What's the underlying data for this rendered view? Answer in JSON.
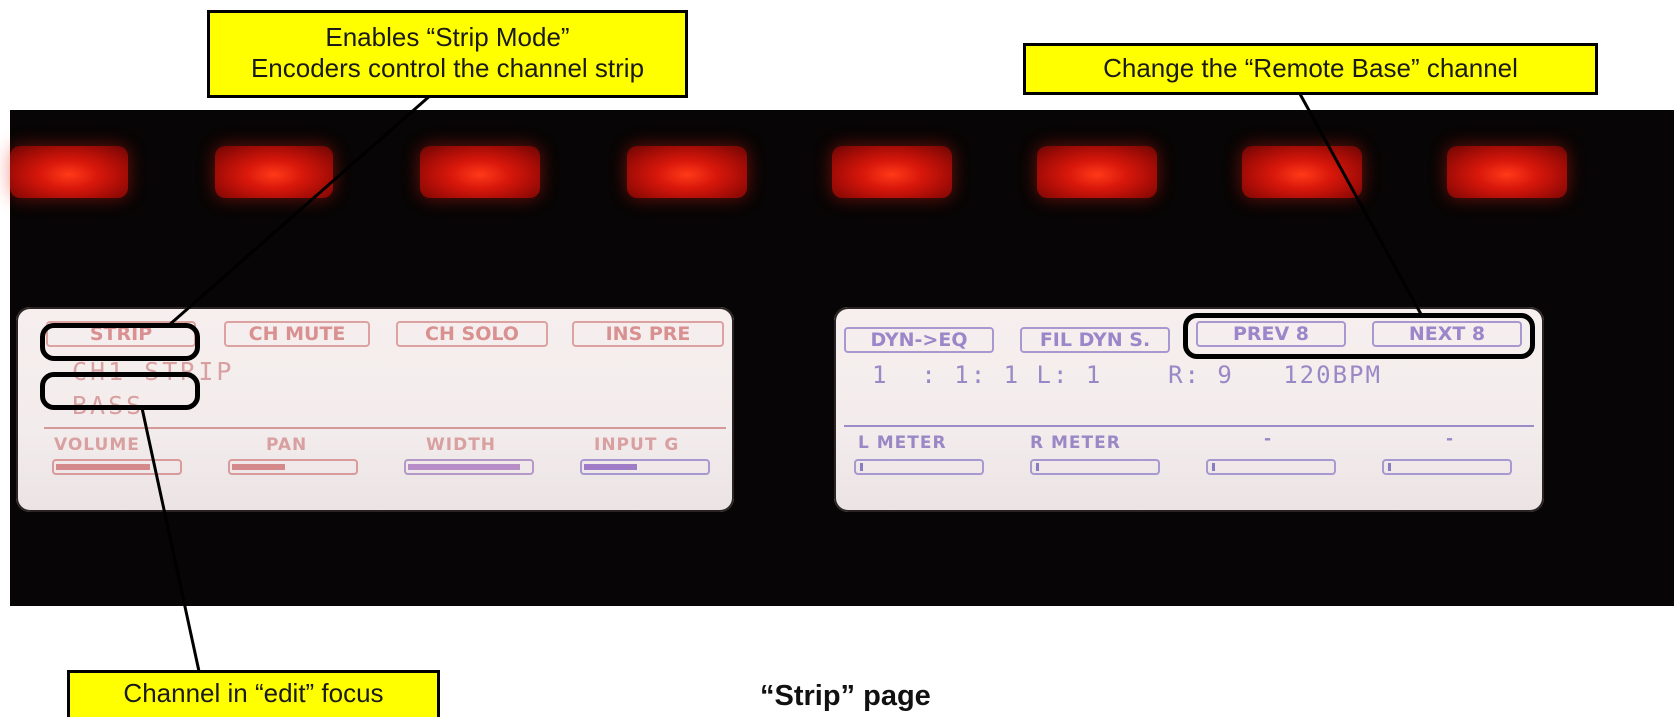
{
  "callouts": {
    "strip_mode_line1": "Enables “Strip Mode”",
    "strip_mode_line2": "Encoders control the channel strip",
    "remote_base": "Change the “Remote Base” channel",
    "edit_focus": "Channel in “edit” focus"
  },
  "caption": "“Strip” page",
  "left_lcd": {
    "softkeys": [
      "STRIP",
      "CH MUTE",
      "CH SOLO",
      "INS PRE"
    ],
    "line1": "CH1 STRIP",
    "line2": "BASS",
    "params": [
      {
        "label": "VOLUME",
        "level": 0.8
      },
      {
        "label": "PAN",
        "level": 0.45
      },
      {
        "label": "WIDTH",
        "level": 0.95
      },
      {
        "label": "INPUT G",
        "level": 0.45
      }
    ]
  },
  "right_lcd": {
    "softkeys": [
      "DYN->EQ",
      "FIL DYN S.",
      "PREV 8",
      "NEXT 8"
    ],
    "status_line": "1  : 1: 1 L: 1    R: 9   120BPM",
    "params": [
      {
        "label": "L METER",
        "level": 0.0
      },
      {
        "label": "R METER",
        "level": 0.0
      },
      {
        "label": "-",
        "level": 0.0
      },
      {
        "label": "-",
        "level": 0.0
      }
    ]
  },
  "colors": {
    "callout_bg": "#ffff00",
    "led_red": "#e01a0c",
    "lcd_pink": "#d89090",
    "lcd_blue": "#9a86c8"
  }
}
